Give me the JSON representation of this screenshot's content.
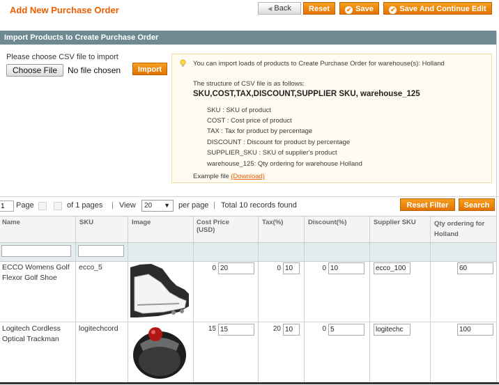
{
  "header": {
    "title": "Add New Purchase Order",
    "back_label": "Back",
    "reset_label": "Reset",
    "save_label": "Save",
    "save_continue_label": "Save And Continue Edit"
  },
  "import_section": {
    "title": "Import Products to Create Purchase Order",
    "prompt": "Please choose CSV file to import",
    "choose_file_label": "Choose File",
    "no_file_label": "No file chosen",
    "import_label": "Import"
  },
  "notice": {
    "intro": "You can import loads of products to Create Purchase Order for warehouse(s): Holland",
    "structure_label": "The structure of CSV file is as follows:",
    "structure": "SKU,COST,TAX,DISCOUNT,SUPPLIER SKU, warehouse_125",
    "fields": [
      "SKU : SKU of product",
      "COST : Cost price of product",
      "TAX : Tax for product by percentage",
      "DISCOUNT : Discount for product by percentage",
      "SUPPLIER_SKU : SKU of supplier's product",
      "warehouse_125: Qty ordering for warehouse Holland"
    ],
    "example_label": "Example file",
    "download_label": "(Download)"
  },
  "pager": {
    "page_value": "1",
    "page_label": "Page",
    "of_pages": "of 1 pages",
    "view_label": "View",
    "view_value": "20",
    "per_page": "per page",
    "total": "Total 10 records found",
    "reset_filter_label": "Reset Filter",
    "search_label": "Search"
  },
  "columns": {
    "name": "Name",
    "sku": "SKU",
    "image": "Image",
    "cost": "Cost Price (USD)",
    "tax": "Tax(%)",
    "discount": "Discount(%)",
    "supplier_sku": "Supplier SKU",
    "qty": "Qty ordering for Holland"
  },
  "rows": [
    {
      "name": "ECCO Womens Golf Flexor Golf Shoe",
      "sku": "ecco_5",
      "cost_current": "0",
      "cost_value": "20",
      "tax_current": "0",
      "tax_value": "10",
      "discount_current": "0",
      "discount_value": "10",
      "supplier_sku_value": "ecco_100",
      "qty_value": "60"
    },
    {
      "name": "Logitech Cordless Optical Trackman",
      "sku": "logitechcord",
      "cost_current": "15",
      "cost_value": "15",
      "tax_current": "20",
      "tax_value": "10",
      "discount_current": "0",
      "discount_value": "5",
      "supplier_sku_value": "logitechc",
      "qty_value": "100"
    }
  ],
  "colors": {
    "accent": "#f18200",
    "title": "#eb5e00",
    "section_header": "#6f8992",
    "notice_bg": "#fffbf0"
  }
}
